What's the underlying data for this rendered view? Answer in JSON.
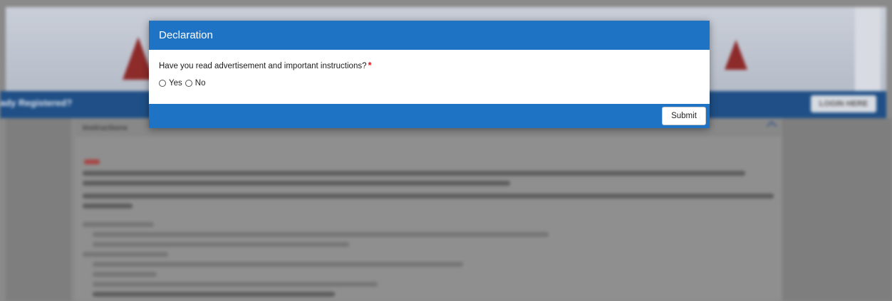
{
  "modal": {
    "title": "Declaration",
    "question": "Have you read advertisement and important instructions?",
    "required_marker": "*",
    "options": [
      {
        "label": "Yes",
        "selected": false
      },
      {
        "label": "No",
        "selected": false
      }
    ],
    "submit_label": "Submit",
    "header_color": "#1e73c4",
    "required_color": "#e0141b"
  },
  "background": {
    "navbar_text": "ady Registered?",
    "login_button": "LOGIN HERE",
    "card_heading": "Instructions"
  }
}
